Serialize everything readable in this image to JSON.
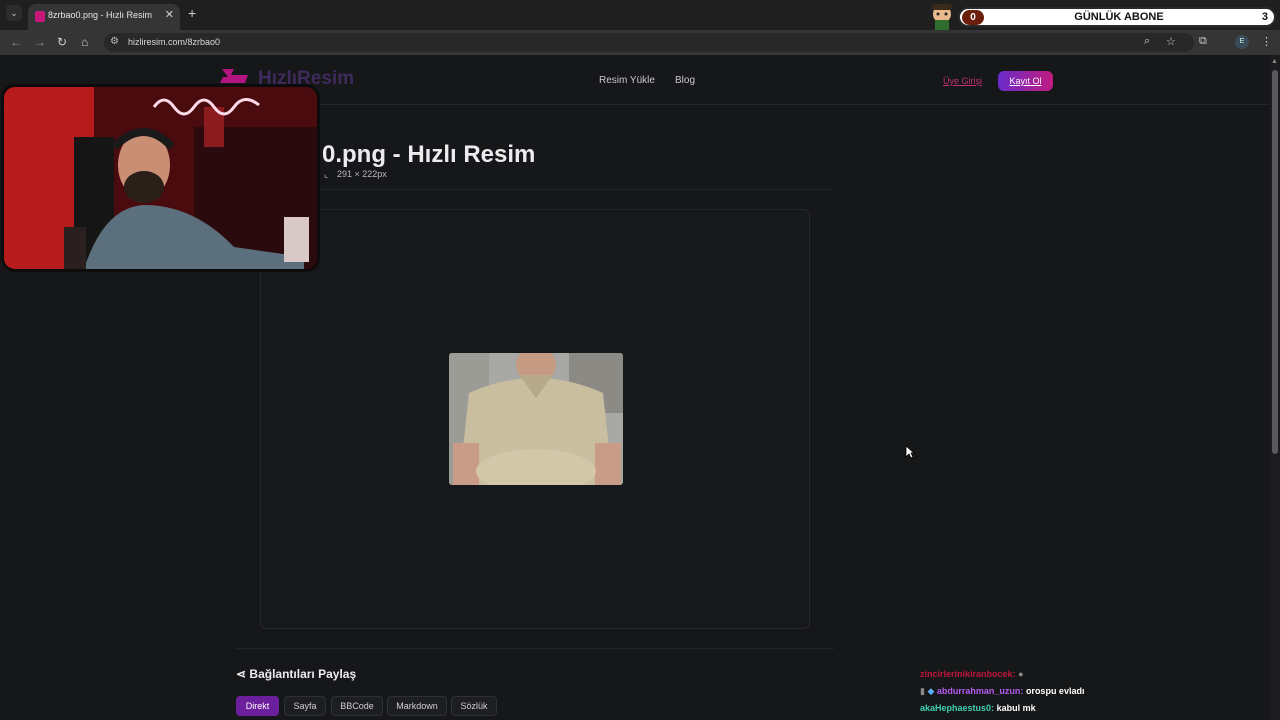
{
  "browser": {
    "tab_title": "8zrbao0.png - Hızlı Resim",
    "url": "hizliresim.com/8zrbao0",
    "profile_initial": "E"
  },
  "overlay": {
    "left_count": "0",
    "title": "GÜNLÜK ABONE",
    "right_count": "3"
  },
  "site": {
    "logo_text": "HızlıResim",
    "nav": [
      "Resim Yükle",
      "Blog"
    ],
    "login": "Üye Girişi",
    "signup": "Kayıt Ol",
    "accent": "#6b1f9c"
  },
  "image_page": {
    "title": "0.png - Hızlı Resim",
    "dimensions": "291 × 222px"
  },
  "share": {
    "title": "Bağlantıları Paylaş",
    "tabs": [
      "Direkt",
      "Sayfa",
      "BBCode",
      "Markdown",
      "Sözlük"
    ],
    "active_tab": "Direkt"
  },
  "chat": [
    {
      "user": "zincirlerinikiranbocek:",
      "message": "",
      "color": "#c0163f"
    },
    {
      "user": "abdurrahman_uzun:",
      "message": "orospu evladı",
      "color": "#b65cf2"
    },
    {
      "user": "akaHephaestus0:",
      "message": "kabul mk",
      "color": "#3fd0b0"
    }
  ]
}
